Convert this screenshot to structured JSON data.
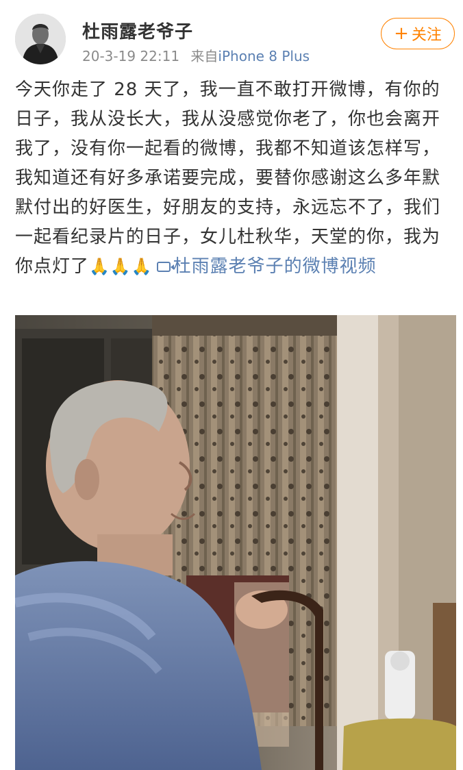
{
  "post": {
    "author": "杜雨露老爷子",
    "date": "20-3-19 22:11",
    "source_prefix": "来自",
    "device": "iPhone 8 Plus",
    "follow_label": "关注",
    "text": "今天你走了 28 天了，我一直不敢打开微博，有你的日子，我从没长大，我从没感觉你老了，你也会离开我了，没有你一起看的微博，我都不知道该怎样写，我知道还有好多承诺要完成，要替你感谢这么多年默默付出的好医生，好朋友的支持，永远忘不了，我们一起看纪录片的日子，女儿杜秋华，天堂的你，我为你点灯了",
    "emoji": "🙏🙏🙏",
    "video_link": "杜雨露老爷子的微博视频"
  },
  "icons": {
    "follow": "plus-icon",
    "video": "video-icon",
    "emoji": "folded-hands-icon"
  },
  "colors": {
    "accent": "#ff8200",
    "link": "#5b80b2",
    "meta": "#8a8a8a",
    "text": "#333333"
  }
}
